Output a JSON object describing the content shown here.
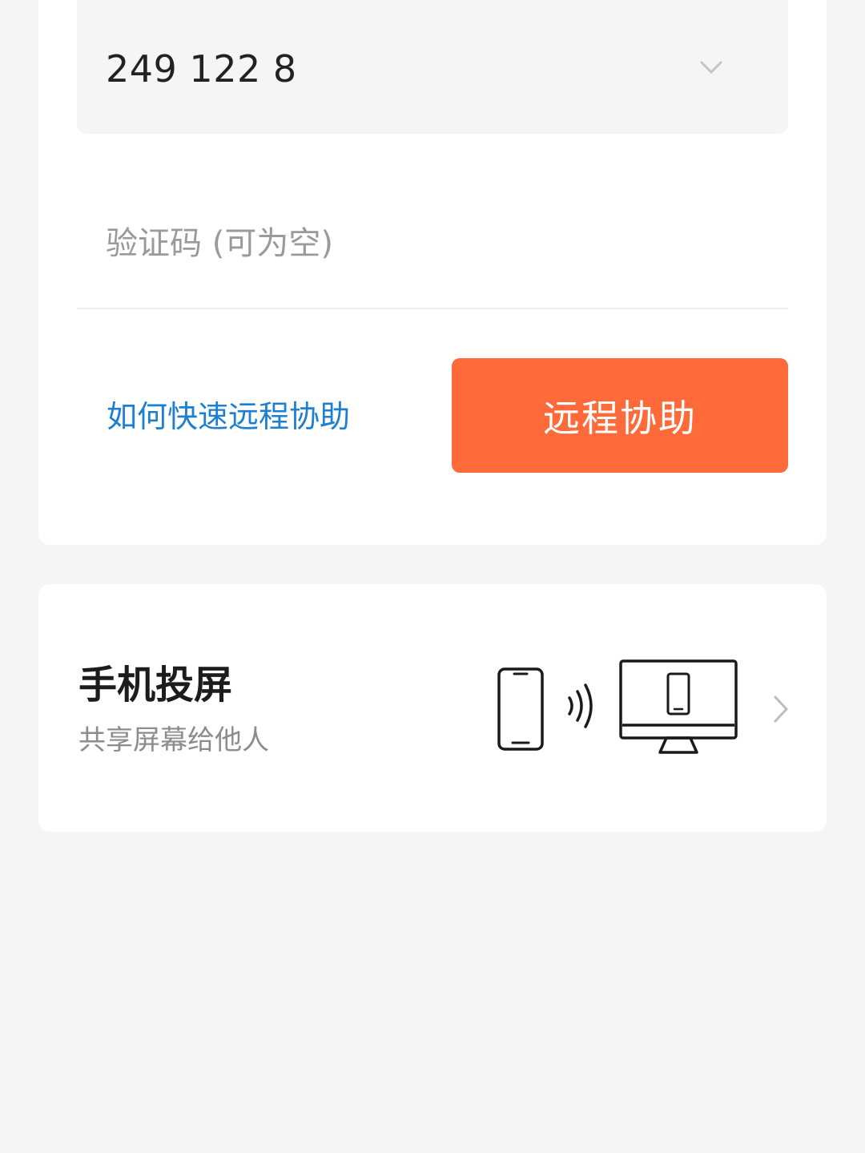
{
  "assist_card": {
    "device_id_value": "249 122 8",
    "device_dropdown_icon": "chevron-down-icon",
    "verification_placeholder": "验证码 (可为空)",
    "verification_value": "",
    "help_link_label": "如何快速远程协助",
    "assist_button_label": "远程协助",
    "colors": {
      "accent": "#ff6a3a",
      "link": "#1d7fd1"
    }
  },
  "mirror_card": {
    "title": "手机投屏",
    "subtitle": "共享屏幕给他人",
    "illustration_icons": [
      "phone-icon",
      "wireless-signal-icon",
      "monitor-icon"
    ],
    "chevron_icon": "chevron-right-icon"
  }
}
